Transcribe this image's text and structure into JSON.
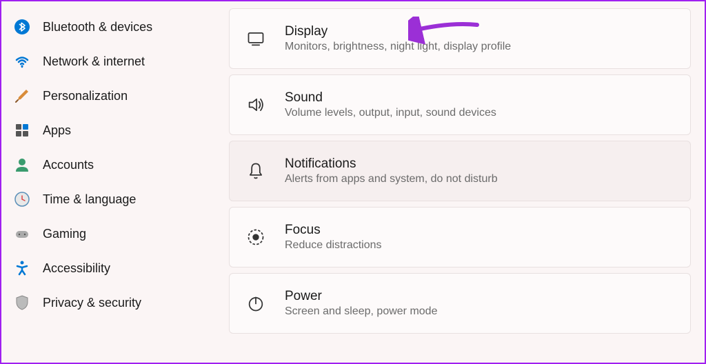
{
  "sidebar": {
    "items": [
      {
        "label": "Bluetooth & devices",
        "icon": "bluetooth",
        "color": "#0078d4"
      },
      {
        "label": "Network & internet",
        "icon": "wifi",
        "color": "#0078d4"
      },
      {
        "label": "Personalization",
        "icon": "brush",
        "color": "#d98c3a"
      },
      {
        "label": "Apps",
        "icon": "apps",
        "color": "#0078d4"
      },
      {
        "label": "Accounts",
        "icon": "person",
        "color": "#3a9b6e"
      },
      {
        "label": "Time & language",
        "icon": "clock",
        "color": "#5a8fb8"
      },
      {
        "label": "Gaming",
        "icon": "gamepad",
        "color": "#888"
      },
      {
        "label": "Accessibility",
        "icon": "accessibility",
        "color": "#0078d4"
      },
      {
        "label": "Privacy & security",
        "icon": "shield",
        "color": "#888"
      }
    ]
  },
  "cards": [
    {
      "title": "Display",
      "subtitle": "Monitors, brightness, night light, display profile",
      "icon": "monitor",
      "highlighted": false
    },
    {
      "title": "Sound",
      "subtitle": "Volume levels, output, input, sound devices",
      "icon": "speaker",
      "highlighted": false
    },
    {
      "title": "Notifications",
      "subtitle": "Alerts from apps and system, do not disturb",
      "icon": "bell",
      "highlighted": true
    },
    {
      "title": "Focus",
      "subtitle": "Reduce distractions",
      "icon": "focus",
      "highlighted": false
    },
    {
      "title": "Power",
      "subtitle": "Screen and sleep, power mode",
      "icon": "power",
      "highlighted": false
    }
  ],
  "annotation": {
    "color": "#9b2fd6"
  }
}
